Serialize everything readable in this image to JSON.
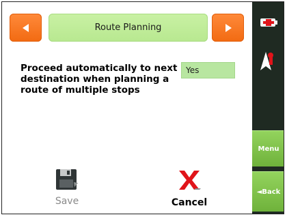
{
  "header": {
    "title": "Route Planning",
    "prev_icon": "arrow-left-icon",
    "next_icon": "arrow-right-icon"
  },
  "setting": {
    "question": "Proceed automatically to next destination when planning a route of multiple stops",
    "value": "Yes"
  },
  "actions": {
    "save_label": "Save",
    "cancel_label": "Cancel",
    "save_icon": "floppy-disk-icon",
    "cancel_icon": "red-x-icon"
  },
  "sidebar": {
    "menu_label": "Menu",
    "back_label": "◄Back",
    "battery_icon": "battery-icon",
    "compass_icon": "north-arrow-icon"
  },
  "colors": {
    "orange": "#f26a12",
    "green_title": "#b8e890",
    "green_field": "#b8e6a0",
    "sidebar_bg": "#1f2a22",
    "sidebar_green": "#6fb23b",
    "cancel_red": "#e0141a"
  }
}
